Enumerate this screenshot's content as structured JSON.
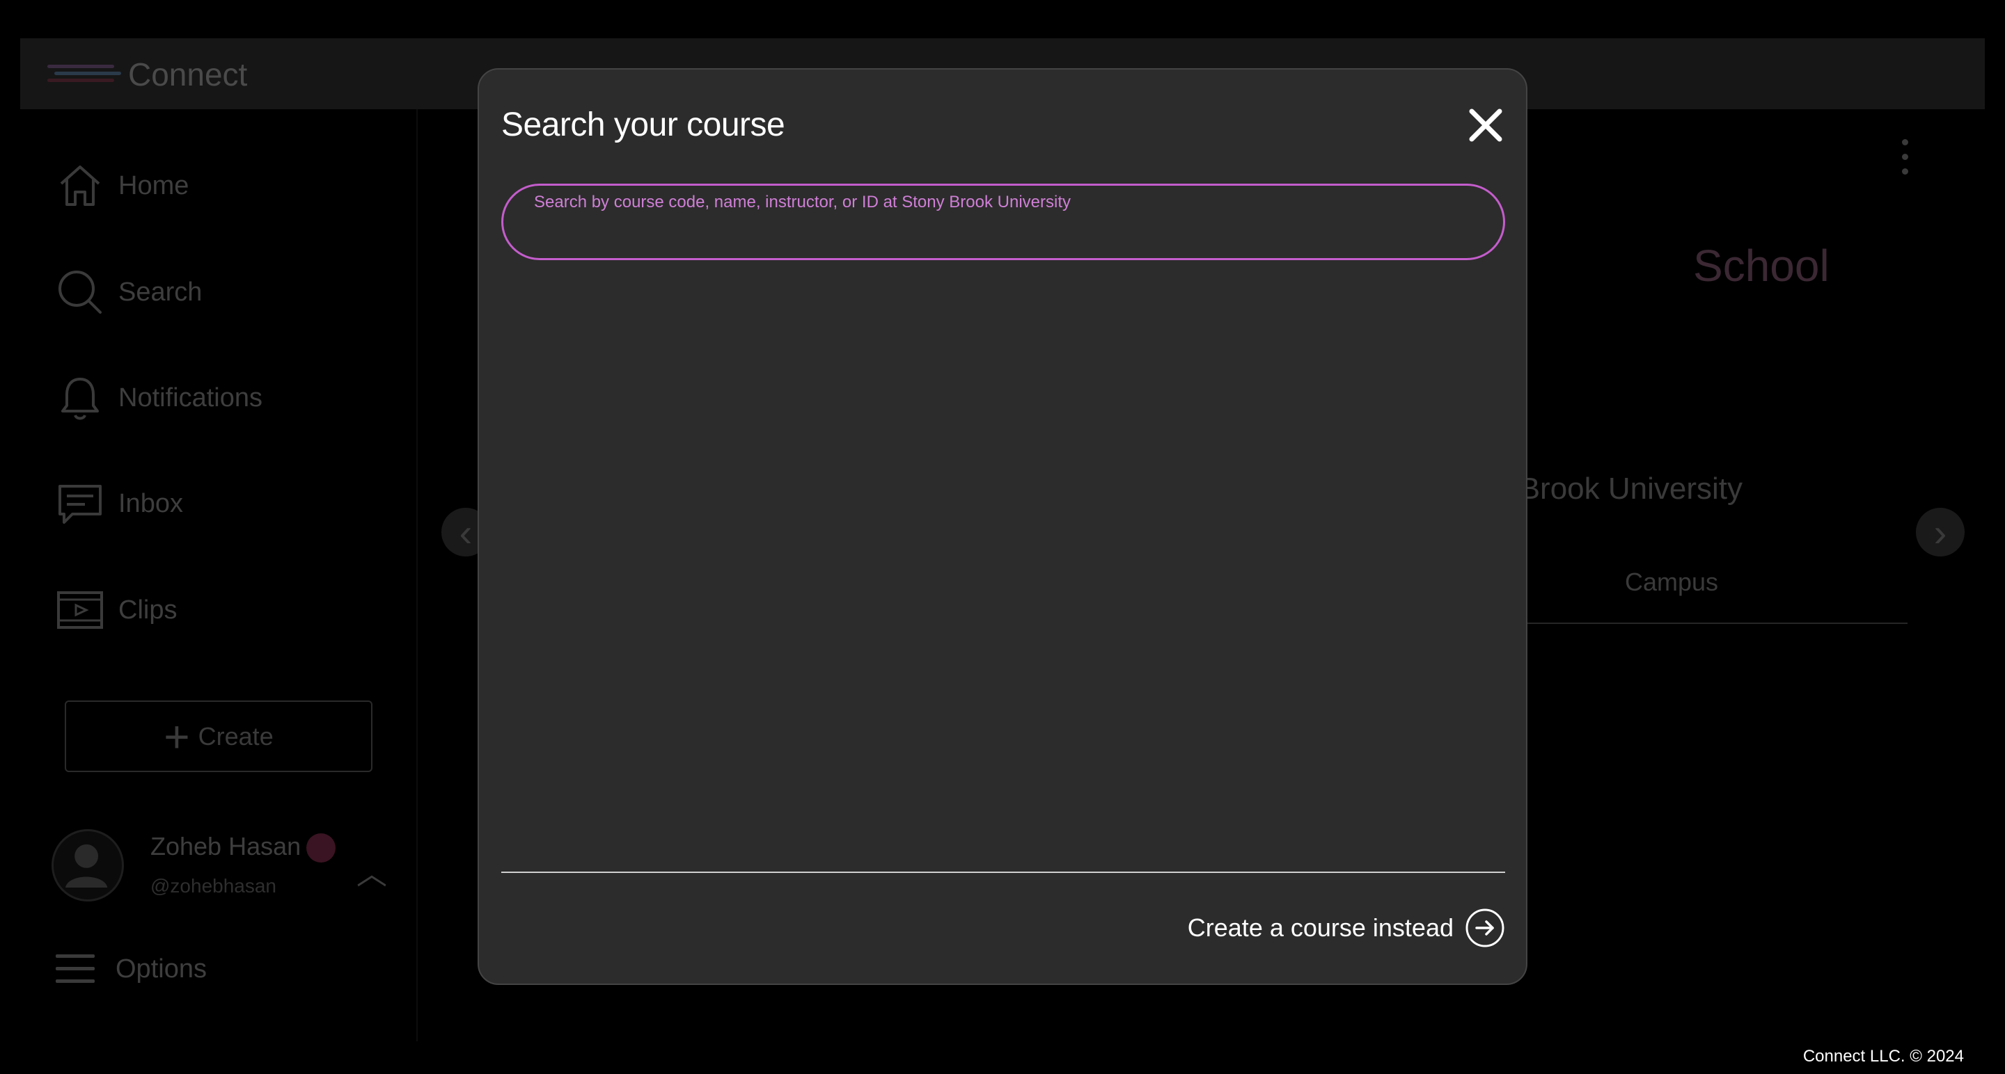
{
  "app": {
    "name": "Connect",
    "footer": "Connect LLC. © 2024"
  },
  "sidebar": {
    "items": [
      {
        "label": "Home",
        "icon": "home-icon"
      },
      {
        "label": "Search",
        "icon": "search-icon"
      },
      {
        "label": "Notifications",
        "icon": "bell-icon"
      },
      {
        "label": "Inbox",
        "icon": "message-icon"
      },
      {
        "label": "Clips",
        "icon": "video-icon"
      }
    ],
    "create_label": "Create",
    "profile": {
      "name": "Zoheb Hasan",
      "handle": "@zohebhasan"
    },
    "options_label": "Options"
  },
  "background": {
    "school_label": "School",
    "university": "ny Brook University",
    "campus_tab": "Campus"
  },
  "modal": {
    "title": "Search your course",
    "search_placeholder": "Search by course code, name, instructor, or ID at Stony Brook University",
    "search_value": "",
    "create_instead_label": "Create a course instead"
  },
  "colors": {
    "accent": "#c45dcc",
    "modal_bg": "#2c2c2c",
    "page_bg": "#000000"
  }
}
